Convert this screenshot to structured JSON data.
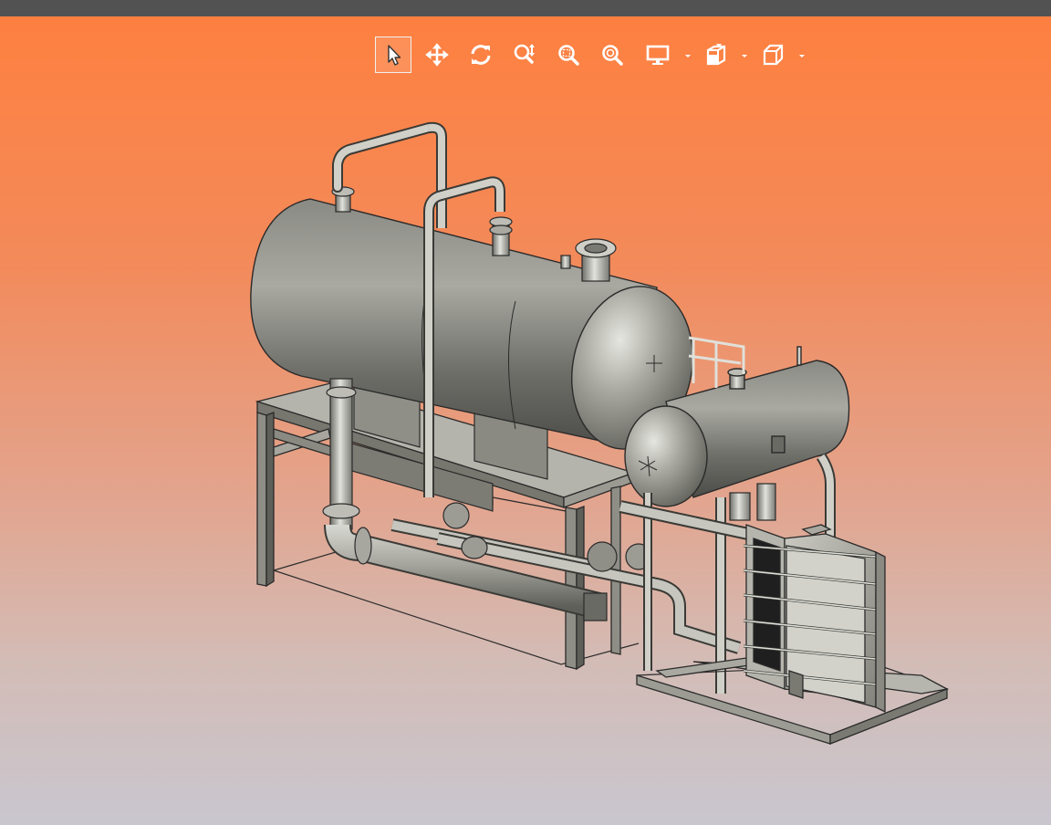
{
  "toolbar": {
    "tools": [
      {
        "name": "select-tool",
        "icon": "arrow-pointer-icon",
        "active": true
      },
      {
        "name": "pan-tool",
        "icon": "move-arrows-icon",
        "active": false
      },
      {
        "name": "rotate-tool",
        "icon": "rotate-icon",
        "active": false
      },
      {
        "name": "zoom-tool",
        "icon": "zoom-icon",
        "active": false
      },
      {
        "name": "zoom-window-tool",
        "icon": "zoom-window-icon",
        "active": false
      },
      {
        "name": "zoom-fit-tool",
        "icon": "zoom-fit-icon",
        "active": false
      },
      {
        "name": "display-mode-menu",
        "icon": "monitor-icon",
        "active": false
      },
      {
        "name": "section-view-menu",
        "icon": "section-cube-icon",
        "active": false
      },
      {
        "name": "view-orientation-menu",
        "icon": "cube-icon",
        "active": false
      }
    ]
  },
  "colors": {
    "top_bar": "#525252",
    "background_top": "#fe8040",
    "background_bottom": "#c9c6cf",
    "metal_light": "#d2d2cc",
    "metal_mid": "#9a9a93",
    "metal_dark": "#5d5d58",
    "plate_dark": "#202020"
  }
}
